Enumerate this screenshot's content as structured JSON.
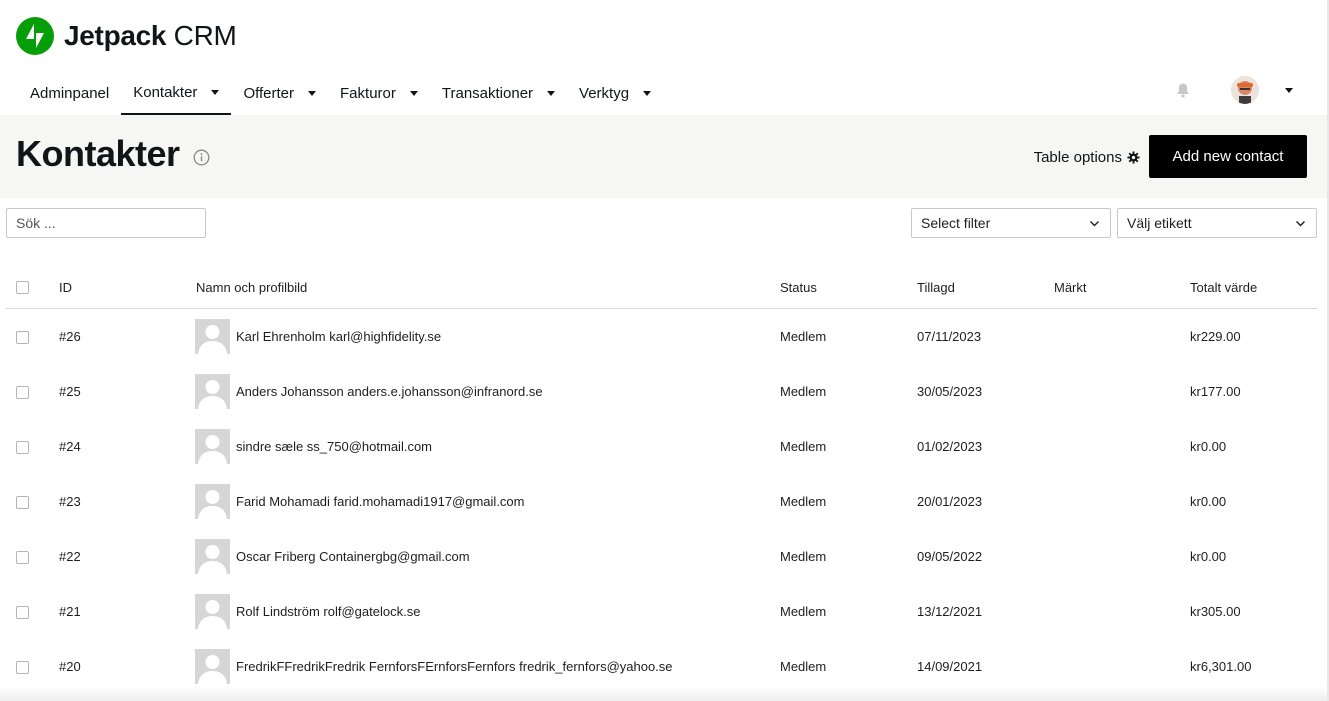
{
  "app": {
    "brand_bold": "Jetpack",
    "brand_rest": " CRM",
    "brand_color": "#069e08"
  },
  "nav": {
    "items": [
      {
        "label": "Adminpanel",
        "has_dropdown": false,
        "active": false
      },
      {
        "label": "Kontakter",
        "has_dropdown": true,
        "active": true
      },
      {
        "label": "Offerter",
        "has_dropdown": true,
        "active": false
      },
      {
        "label": "Fakturor",
        "has_dropdown": true,
        "active": false
      },
      {
        "label": "Transaktioner",
        "has_dropdown": true,
        "active": false
      },
      {
        "label": "Verktyg",
        "has_dropdown": true,
        "active": false
      }
    ],
    "notification_icon": "bell-icon",
    "user_icon": "user-avatar"
  },
  "header": {
    "title": "Kontakter",
    "info_icon": "info-icon",
    "table_options_label": "Table options",
    "add_button_label": "Add new contact"
  },
  "controls": {
    "search_placeholder": "Sök ...",
    "filter_value": "Select filter",
    "tag_value": "Välj etikett"
  },
  "table": {
    "columns": [
      "ID",
      "Namn och profilbild",
      "Status",
      "Tillagd",
      "Märkt",
      "Totalt värde"
    ],
    "rows": [
      {
        "id": "#26",
        "name": "Karl Ehrenholm karl@highfidelity.se",
        "status": "Medlem",
        "added": "07/11/2023",
        "tagged": "",
        "total": "kr229.00"
      },
      {
        "id": "#25",
        "name": "Anders Johansson anders.e.johansson@infranord.se",
        "status": "Medlem",
        "added": "30/05/2023",
        "tagged": "",
        "total": "kr177.00"
      },
      {
        "id": "#24",
        "name": "sindre sæle ss_750@hotmail.com",
        "status": "Medlem",
        "added": "01/02/2023",
        "tagged": "",
        "total": "kr0.00"
      },
      {
        "id": "#23",
        "name": "Farid Mohamadi farid.mohamadi1917@gmail.com",
        "status": "Medlem",
        "added": "20/01/2023",
        "tagged": "",
        "total": "kr0.00"
      },
      {
        "id": "#22",
        "name": "Oscar Friberg Containergbg@gmail.com",
        "status": "Medlem",
        "added": "09/05/2022",
        "tagged": "",
        "total": "kr0.00"
      },
      {
        "id": "#21",
        "name": "Rolf Lindström rolf@gatelock.se",
        "status": "Medlem",
        "added": "13/12/2021",
        "tagged": "",
        "total": "kr305.00"
      },
      {
        "id": "#20",
        "name": "FredrikFFredrikFredrik FernforsFErnforsFernfors fredrik_fernfors@yahoo.se",
        "status": "Medlem",
        "added": "14/09/2021",
        "tagged": "",
        "total": "kr6,301.00"
      }
    ]
  }
}
